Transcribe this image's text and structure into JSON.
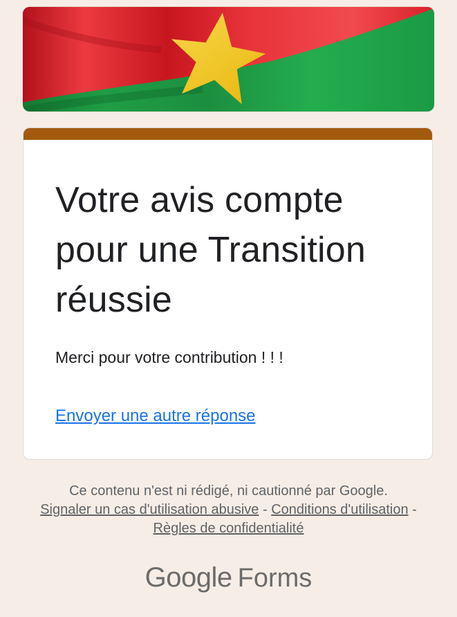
{
  "banner": {
    "description_icon": "burkina-faso-flag-image"
  },
  "card": {
    "accent_color": "#a45a0e",
    "title": "Votre avis compte pour une Transition réussie",
    "message": "Merci pour votre contribution ! ! !",
    "another_response_link": "Envoyer une autre réponse"
  },
  "footer": {
    "disclaimer": "Ce contenu n'est ni rédigé, ni cautionné par Google.",
    "report_abuse": "Signaler un cas d'utilisation abusive",
    "separator": " - ",
    "terms": "Conditions d'utilisation",
    "privacy": "Règles de confidentialité"
  },
  "logo": {
    "brand": "Google",
    "product": "Forms"
  },
  "colors": {
    "background": "#f6ede6",
    "link": "#1a73e8",
    "flag_red": "#e0222b",
    "flag_green": "#1fa34a",
    "flag_star": "#f7d116"
  }
}
